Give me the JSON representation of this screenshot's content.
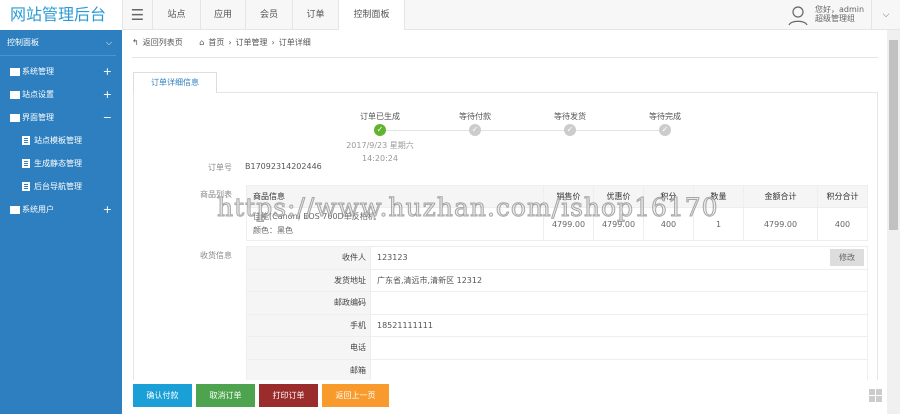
{
  "header": {
    "logo": "网站管理后台",
    "tabs": [
      "站点",
      "应用",
      "会员",
      "订单",
      "控制面板"
    ],
    "user_greeting": "您好，admin",
    "user_role": "超级管理组"
  },
  "sidebar": {
    "title": "控制面板",
    "items": [
      {
        "label": "系统管理",
        "toggle": "+"
      },
      {
        "label": "站点设置",
        "toggle": "+"
      },
      {
        "label": "界面管理",
        "toggle": "−"
      },
      {
        "label": "系统用户",
        "toggle": "+"
      }
    ],
    "sub_items": [
      "站点模板管理",
      "生成静态管理",
      "后台导航管理"
    ]
  },
  "breadcrumb": {
    "back": "返回列表页",
    "home": "首页",
    "level1": "订单管理",
    "level2": "订单详细"
  },
  "tab": "订单详细信息",
  "steps": [
    {
      "label": "订单已生成",
      "done": true
    },
    {
      "label": "等待付款",
      "done": false
    },
    {
      "label": "等待发货",
      "done": false
    },
    {
      "label": "等待完成",
      "done": false
    }
  ],
  "step_date": "2017/9/23 星期六",
  "step_time": "14:20:24",
  "order": {
    "label": "订单号",
    "value": "B17092314202446"
  },
  "products": {
    "label": "商品列表",
    "headers": [
      "商品信息",
      "销售价",
      "优惠价",
      "积分",
      "数量",
      "金额合计",
      "积分合计"
    ],
    "rows": [
      {
        "name": "佳能(Canon) EOS 700D单反相机",
        "spec": "颜色：黑色",
        "price": "4799.00",
        "discount": "4799.00",
        "points": "400",
        "qty": "1",
        "total": "4799.00",
        "points_total": "400"
      }
    ]
  },
  "shipping": {
    "label": "收货信息",
    "edit": "修改",
    "rows": [
      {
        "k": "收件人",
        "v": "123123"
      },
      {
        "k": "发货地址",
        "v": "广东省,清远市,清新区 12312"
      },
      {
        "k": "邮政编码",
        "v": ""
      },
      {
        "k": "手机",
        "v": "18521111111"
      },
      {
        "k": "电话",
        "v": ""
      },
      {
        "k": "邮箱",
        "v": ""
      }
    ]
  },
  "buttons": {
    "confirm": "确认付款",
    "cancel": "取消订单",
    "print": "打印订单",
    "back": "返回上一页"
  },
  "colors": {
    "confirm": "#1a9fd6",
    "cancel": "#4ea44e",
    "print": "#9b2c2c",
    "back": "#f99a2c",
    "sidebar": "#2d7fbf"
  },
  "watermark": "https://www.huzhan.com/ishop16170"
}
